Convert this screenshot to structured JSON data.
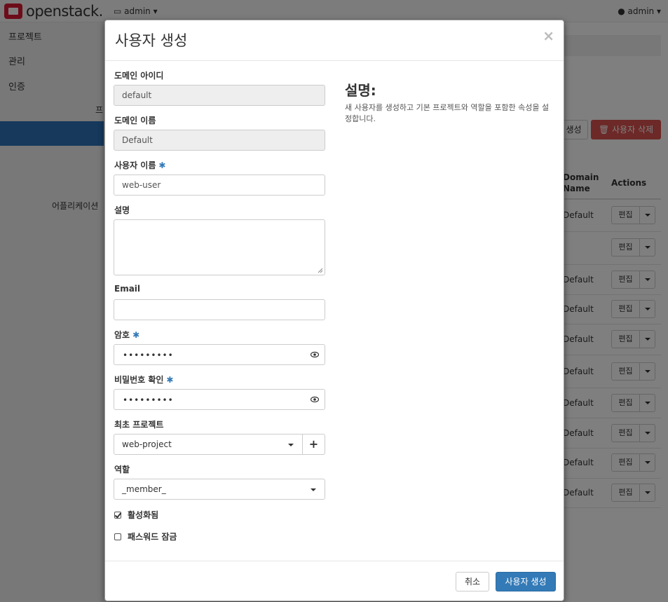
{
  "app": {
    "logo_text": "openstack.",
    "project_menu": "admin",
    "user_menu": "admin"
  },
  "sidebar": {
    "items": [
      {
        "label": "프로젝트"
      },
      {
        "label": "관리"
      },
      {
        "label": "인증"
      }
    ],
    "sub_label": "프",
    "app_label": "어플리케이션"
  },
  "background_table": {
    "create_button": "생성",
    "delete_button": "사용자 삭제",
    "col_domain": "Domain Name",
    "col_actions": "Actions",
    "rows": [
      {
        "domain": "Default",
        "action": "편집"
      },
      {
        "domain": "",
        "action": "편집"
      },
      {
        "domain": "Default",
        "action": "편집"
      },
      {
        "domain": "Default",
        "action": "편집"
      },
      {
        "domain": "Default",
        "action": "편집"
      },
      {
        "domain": "Default",
        "action": "편집"
      },
      {
        "domain": "Default",
        "action": "편집"
      },
      {
        "domain": "Default",
        "action": "편집"
      },
      {
        "domain": "Default",
        "action": "편집"
      },
      {
        "domain": "Default",
        "action": "편집"
      }
    ]
  },
  "modal": {
    "title": "사용자 생성",
    "close_glyph": "×",
    "fields": {
      "domain_id": {
        "label": "도메인 아이디",
        "value": "default"
      },
      "domain_name": {
        "label": "도메인 이름",
        "value": "Default"
      },
      "username": {
        "label": "사용자 이름",
        "value": "web-user",
        "required_mark": "✱"
      },
      "description": {
        "label": "설명",
        "value": ""
      },
      "email": {
        "label": "Email",
        "value": ""
      },
      "password": {
        "label": "암호",
        "value": "•••••••••",
        "required_mark": "✱"
      },
      "confirm_password": {
        "label": "비밀번호 확인",
        "value": "•••••••••",
        "required_mark": "✱"
      },
      "primary_project": {
        "label": "최초 프로젝트",
        "value": "web-project",
        "add_glyph": "+"
      },
      "role": {
        "label": "역할",
        "value": "_member_"
      }
    },
    "checkboxes": {
      "enabled": {
        "label": "활성화됨",
        "checked": true
      },
      "lock_password": {
        "label": "패스워드 잠금",
        "checked": false
      }
    },
    "help": {
      "title": "설명:",
      "text": "새 사용자를 생성하고 기본 프로젝트와 역할을 포함한 속성을 설정합니다."
    },
    "footer": {
      "cancel": "취소",
      "submit": "사용자 생성"
    }
  },
  "colors": {
    "primary": "#337ab7",
    "danger": "#d9534f",
    "sidebar_active": "#2c72b8",
    "brand_red": "#da1a32"
  }
}
